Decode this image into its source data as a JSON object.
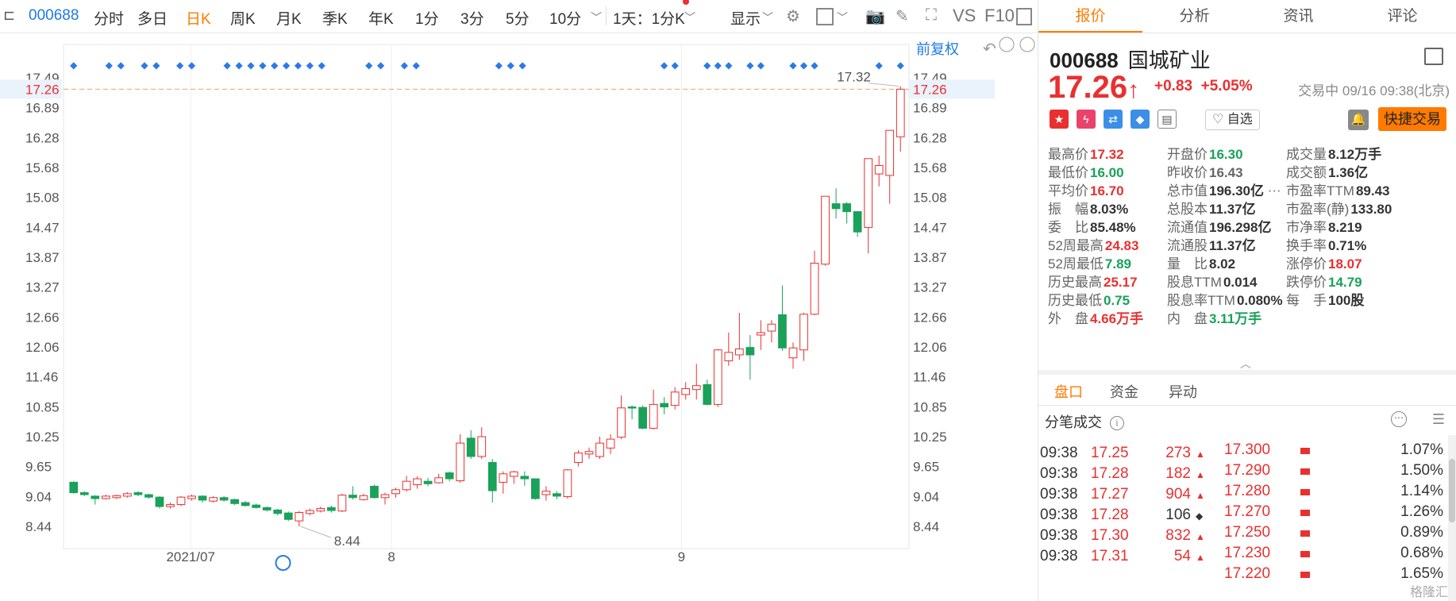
{
  "toolbar": {
    "code": "000688",
    "periods": [
      "分时",
      "多日",
      "日K",
      "周K",
      "月K",
      "季K",
      "年K",
      "1分",
      "3分",
      "5分",
      "10分"
    ],
    "active_period": "日K",
    "period_select": "1天：1分K",
    "display": "显示",
    "vs": "VS",
    "f10": "F10",
    "fq": "前复权"
  },
  "chart": {
    "last_price_label": "17.26",
    "high_label": "17.32",
    "low_label": "8.44",
    "y_ticks": [
      "17.49",
      "16.89",
      "16.28",
      "15.68",
      "15.08",
      "14.47",
      "13.87",
      "13.27",
      "12.66",
      "12.06",
      "11.46",
      "10.85",
      "10.25",
      "9.65",
      "9.04",
      "8.44"
    ],
    "x_ticks": [
      "2021/07",
      "8",
      "9"
    ]
  },
  "chart_data": {
    "type": "candlestick",
    "y_ticks": [
      17.49,
      16.89,
      16.28,
      15.68,
      15.08,
      14.47,
      13.87,
      13.27,
      12.66,
      12.06,
      11.46,
      10.85,
      10.25,
      9.65,
      9.04,
      8.44
    ],
    "x_tick_labels": [
      "2021/07",
      "8",
      "9"
    ],
    "last_price": 17.26,
    "marked_high": 17.32,
    "marked_low": 8.44,
    "candles": [
      [
        9.33,
        9.12,
        9.35,
        9.1
      ],
      [
        9.12,
        9.08,
        9.15,
        9.05
      ],
      [
        9.05,
        9.0,
        9.07,
        8.88
      ],
      [
        9.0,
        9.05,
        9.08,
        8.98
      ],
      [
        9.02,
        9.06,
        9.08,
        8.99
      ],
      [
        9.05,
        9.1,
        9.13,
        9.02
      ],
      [
        9.12,
        9.08,
        9.15,
        9.05
      ],
      [
        9.08,
        9.03,
        9.1,
        9.0
      ],
      [
        9.03,
        8.84,
        9.05,
        8.8
      ],
      [
        8.84,
        8.88,
        8.92,
        8.8
      ],
      [
        8.88,
        9.03,
        9.05,
        8.85
      ],
      [
        9.0,
        9.05,
        9.08,
        8.96
      ],
      [
        9.05,
        8.97,
        9.07,
        8.92
      ],
      [
        8.95,
        9.02,
        9.05,
        8.92
      ],
      [
        9.02,
        8.97,
        9.05,
        8.94
      ],
      [
        8.98,
        8.9,
        9.0,
        8.87
      ],
      [
        8.92,
        8.86,
        8.95,
        8.84
      ],
      [
        8.87,
        8.82,
        8.9,
        8.8
      ],
      [
        8.82,
        8.77,
        8.84,
        8.74
      ],
      [
        8.77,
        8.7,
        8.79,
        8.66
      ],
      [
        8.71,
        8.58,
        8.74,
        8.55
      ],
      [
        8.55,
        8.72,
        8.75,
        8.44
      ],
      [
        8.7,
        8.76,
        8.8,
        8.66
      ],
      [
        8.75,
        8.8,
        8.84,
        8.72
      ],
      [
        8.82,
        8.76,
        8.86,
        8.72
      ],
      [
        8.75,
        9.07,
        9.1,
        8.73
      ],
      [
        9.07,
        9.02,
        9.25,
        8.98
      ],
      [
        8.98,
        9.06,
        9.1,
        8.96
      ],
      [
        9.25,
        9.02,
        9.28,
        9.0
      ],
      [
        9.02,
        9.08,
        9.12,
        8.88
      ],
      [
        9.1,
        9.18,
        9.22,
        9.02
      ],
      [
        9.18,
        9.35,
        9.46,
        9.14
      ],
      [
        9.28,
        9.4,
        9.45,
        9.2
      ],
      [
        9.35,
        9.3,
        9.42,
        9.25
      ],
      [
        9.32,
        9.42,
        9.5,
        9.3
      ],
      [
        9.52,
        9.4,
        9.55,
        9.35
      ],
      [
        9.36,
        10.12,
        10.3,
        9.32
      ],
      [
        10.22,
        9.85,
        10.38,
        9.8
      ],
      [
        9.85,
        10.25,
        10.44,
        9.8
      ],
      [
        9.73,
        9.16,
        9.8,
        8.92
      ],
      [
        9.33,
        9.5,
        9.55,
        9.1
      ],
      [
        9.45,
        9.54,
        9.56,
        9.3
      ],
      [
        9.45,
        9.4,
        9.55,
        9.26
      ],
      [
        9.4,
        9.0,
        9.4,
        8.98
      ],
      [
        9.08,
        9.15,
        9.25,
        8.96
      ],
      [
        9.1,
        9.05,
        9.15,
        8.99
      ],
      [
        9.04,
        9.58,
        9.6,
        9.0
      ],
      [
        9.73,
        9.92,
        9.98,
        9.65
      ],
      [
        9.9,
        9.95,
        10.03,
        9.8
      ],
      [
        9.85,
        10.12,
        10.25,
        9.8
      ],
      [
        10.02,
        10.2,
        10.3,
        9.9
      ],
      [
        10.24,
        10.83,
        11.08,
        10.2
      ],
      [
        10.85,
        10.83,
        10.88,
        10.6
      ],
      [
        10.84,
        10.42,
        10.88,
        10.4
      ],
      [
        10.42,
        10.9,
        11.2,
        10.4
      ],
      [
        10.92,
        10.85,
        11.05,
        10.7
      ],
      [
        10.88,
        11.15,
        11.25,
        10.8
      ],
      [
        11.1,
        11.22,
        11.35,
        11.0
      ],
      [
        11.2,
        11.28,
        11.72,
        11.0
      ],
      [
        11.3,
        10.9,
        11.4,
        10.88
      ],
      [
        10.9,
        12.0,
        12.02,
        10.85
      ],
      [
        11.78,
        11.95,
        12.35,
        11.68
      ],
      [
        11.9,
        12.02,
        12.75,
        11.8
      ],
      [
        12.05,
        11.9,
        12.3,
        11.4
      ],
      [
        12.3,
        12.35,
        12.6,
        12.0
      ],
      [
        12.38,
        12.52,
        12.6,
        12.15
      ],
      [
        12.71,
        12.04,
        13.3,
        11.98
      ],
      [
        11.84,
        12.04,
        12.15,
        11.62
      ],
      [
        12.0,
        12.72,
        12.75,
        11.78
      ],
      [
        12.72,
        13.75,
        14.0,
        12.7
      ],
      [
        13.73,
        15.1,
        15.1,
        13.7
      ],
      [
        14.95,
        14.85,
        15.26,
        14.65
      ],
      [
        14.95,
        14.79,
        14.98,
        14.55
      ],
      [
        14.79,
        14.38,
        14.8,
        14.28
      ],
      [
        14.47,
        15.86,
        15.86,
        13.95
      ],
      [
        15.55,
        15.72,
        15.92,
        15.3
      ],
      [
        15.52,
        16.43,
        16.43,
        14.95
      ],
      [
        16.3,
        17.26,
        17.32,
        16.0
      ]
    ]
  },
  "quote": {
    "tabs": [
      "报价",
      "分析",
      "资讯",
      "评论"
    ],
    "code": "000688",
    "name": "国城矿业",
    "price": "17.26",
    "arrow": "↑",
    "change": "+0.83",
    "change_pct": "+5.05%",
    "status": "交易中 09/16 09:38(北京)",
    "watch": "自选",
    "trade_button": "快捷交易",
    "stats": [
      {
        "label": "最高价",
        "value": "17.32",
        "color": "#e93030"
      },
      {
        "label": "开盘价",
        "value": "16.30",
        "color": "#1aa15a"
      },
      {
        "label": "成交量",
        "value": "8.12万手",
        "color": "#333333"
      },
      {
        "label": "最低价",
        "value": "16.00",
        "color": "#1aa15a"
      },
      {
        "label": "昨收价",
        "value": "16.43",
        "color": "#666666"
      },
      {
        "label": "成交额",
        "value": "1.36亿",
        "color": "#333333"
      },
      {
        "label": "平均价",
        "value": "16.70",
        "color": "#e93030"
      },
      {
        "label": "总市值",
        "value": "196.30亿",
        "color": "#333333"
      },
      {
        "label": "市盈率TTM",
        "value": "89.43",
        "color": "#333333"
      },
      {
        "label": "振　幅",
        "value": "8.03%",
        "color": "#333333"
      },
      {
        "label": "总股本",
        "value": "11.37亿",
        "color": "#333333"
      },
      {
        "label": "市盈率(静)",
        "value": "133.80",
        "color": "#333333"
      },
      {
        "label": "委　比",
        "value": "85.48%",
        "color": "#333333"
      },
      {
        "label": "流通值",
        "value": "196.298亿",
        "color": "#333333"
      },
      {
        "label": "市净率",
        "value": "8.219",
        "color": "#333333"
      },
      {
        "label": "52周最高",
        "value": "24.83",
        "color": "#e93030"
      },
      {
        "label": "流通股",
        "value": "11.37亿",
        "color": "#333333"
      },
      {
        "label": "换手率",
        "value": "0.71%",
        "color": "#333333"
      },
      {
        "label": "52周最低",
        "value": "7.89",
        "color": "#1aa15a"
      },
      {
        "label": "量　比",
        "value": "8.02",
        "color": "#333333"
      },
      {
        "label": "涨停价",
        "value": "18.07",
        "color": "#e93030"
      },
      {
        "label": "历史最高",
        "value": "25.17",
        "color": "#e93030"
      },
      {
        "label": "股息TTM",
        "value": "0.014",
        "color": "#333333"
      },
      {
        "label": "跌停价",
        "value": "14.79",
        "color": "#1aa15a"
      },
      {
        "label": "历史最低",
        "value": "0.75",
        "color": "#1aa15a"
      },
      {
        "label": "股息率TTM",
        "value": "0.080%",
        "color": "#333333"
      },
      {
        "label": "每　手",
        "value": "100股",
        "color": "#333333"
      },
      {
        "label": "外　盘",
        "value": "4.66万手",
        "color": "#e93030"
      },
      {
        "label": "内　盘",
        "value": "3.11万手",
        "color": "#1aa15a"
      }
    ],
    "subtabs": [
      "盘口",
      "资金",
      "异动"
    ],
    "trades_title": "分笔成交",
    "trades": [
      {
        "time": "09:38",
        "price": "17.25",
        "vol": "273",
        "dir": "▲",
        "vcolor": "#e93030"
      },
      {
        "time": "09:38",
        "price": "17.28",
        "vol": "182",
        "dir": "▲",
        "vcolor": "#e93030"
      },
      {
        "time": "09:38",
        "price": "17.27",
        "vol": "904",
        "dir": "▲",
        "vcolor": "#e93030"
      },
      {
        "time": "09:38",
        "price": "17.28",
        "vol": "106",
        "dir": "◆",
        "vcolor": "#333333"
      },
      {
        "time": "09:38",
        "price": "17.30",
        "vol": "832",
        "dir": "▲",
        "vcolor": "#e93030"
      },
      {
        "time": "09:38",
        "price": "17.31",
        "vol": "54",
        "dir": "▲",
        "vcolor": "#e93030"
      }
    ],
    "levels": [
      {
        "price": "17.300",
        "pct": "1.07%"
      },
      {
        "price": "17.290",
        "pct": "1.50%"
      },
      {
        "price": "17.280",
        "pct": "1.14%"
      },
      {
        "price": "17.270",
        "pct": "1.26%"
      },
      {
        "price": "17.250",
        "pct": "0.89%"
      },
      {
        "price": "17.230",
        "pct": "0.68%"
      },
      {
        "price": "17.220",
        "pct": "1.65%"
      }
    ],
    "watermark": "格隆汇"
  }
}
